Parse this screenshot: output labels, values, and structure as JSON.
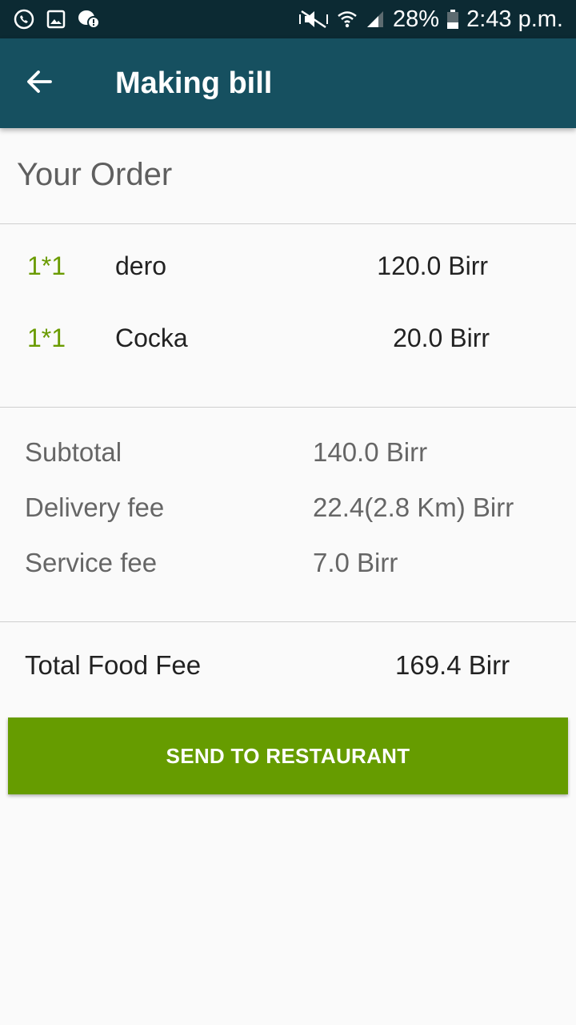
{
  "status_bar": {
    "battery": "28%",
    "time": "2:43 p.m.",
    "icons": [
      "call-icon",
      "image-icon",
      "notification-icon",
      "mute-icon",
      "wifi-icon",
      "signal-icon",
      "battery-icon"
    ]
  },
  "app_bar": {
    "title": "Making bill",
    "back_icon": "arrow-back-icon"
  },
  "section_title": "Your Order",
  "order_items": [
    {
      "qty": "1*1",
      "name": "dero",
      "price": "120.0 Birr"
    },
    {
      "qty": "1*1",
      "name": "Cocka",
      "price": "20.0 Birr"
    }
  ],
  "fees": [
    {
      "label": "Subtotal",
      "value": "140.0 Birr"
    },
    {
      "label": "Delivery fee",
      "value": "22.4(2.8 Km) Birr"
    },
    {
      "label": "Service fee",
      "value": "7.0 Birr"
    }
  ],
  "total": {
    "label": "Total Food Fee",
    "value": "169.4 Birr"
  },
  "send_button": {
    "label": "SEND TO RESTAURANT"
  },
  "colors": {
    "status_bar": "#0c2a33",
    "app_bar": "#165060",
    "accent_green": "#669c00",
    "qty_green": "#6a9b00",
    "background": "#fafafa"
  }
}
